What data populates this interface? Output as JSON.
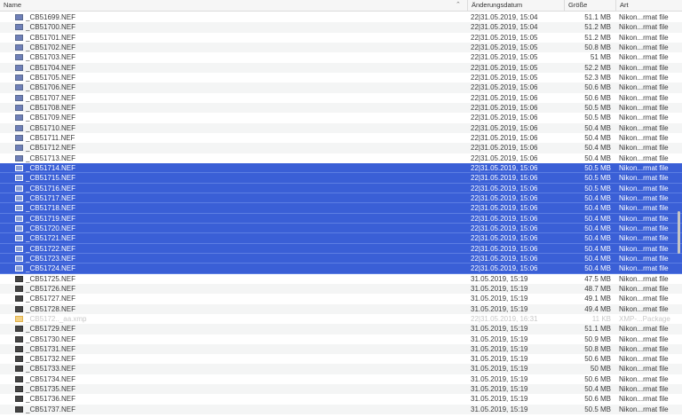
{
  "columns": {
    "name": "Name",
    "date": "Änderungsdatum",
    "size": "Größe",
    "kind": "Art",
    "sort_indicator": "⌃"
  },
  "rows": [
    {
      "name": "_CB51699.NEF",
      "date": "22|31.05.2019, 15:04",
      "size": "51.1 MB",
      "kind": "Nikon...rmat file",
      "selected": false,
      "icon": "nef-file-icon"
    },
    {
      "name": "_CB51700.NEF",
      "date": "22|31.05.2019, 15:04",
      "size": "51.2 MB",
      "kind": "Nikon...rmat file",
      "selected": false,
      "icon": "nef-file-icon"
    },
    {
      "name": "_CB51701.NEF",
      "date": "22|31.05.2019, 15:05",
      "size": "51.2 MB",
      "kind": "Nikon...rmat file",
      "selected": false,
      "icon": "nef-file-icon"
    },
    {
      "name": "_CB51702.NEF",
      "date": "22|31.05.2019, 15:05",
      "size": "50.8 MB",
      "kind": "Nikon...rmat file",
      "selected": false,
      "icon": "nef-file-icon"
    },
    {
      "name": "_CB51703.NEF",
      "date": "22|31.05.2019, 15:05",
      "size": "51 MB",
      "kind": "Nikon...rmat file",
      "selected": false,
      "icon": "nef-file-icon"
    },
    {
      "name": "_CB51704.NEF",
      "date": "22|31.05.2019, 15:05",
      "size": "52.2 MB",
      "kind": "Nikon...rmat file",
      "selected": false,
      "icon": "nef-file-icon"
    },
    {
      "name": "_CB51705.NEF",
      "date": "22|31.05.2019, 15:05",
      "size": "52.3 MB",
      "kind": "Nikon...rmat file",
      "selected": false,
      "icon": "nef-file-icon"
    },
    {
      "name": "_CB51706.NEF",
      "date": "22|31.05.2019, 15:06",
      "size": "50.6 MB",
      "kind": "Nikon...rmat file",
      "selected": false,
      "icon": "nef-file-icon"
    },
    {
      "name": "_CB51707.NEF",
      "date": "22|31.05.2019, 15:06",
      "size": "50.6 MB",
      "kind": "Nikon...rmat file",
      "selected": false,
      "icon": "nef-file-icon"
    },
    {
      "name": "_CB51708.NEF",
      "date": "22|31.05.2019, 15:06",
      "size": "50.5 MB",
      "kind": "Nikon...rmat file",
      "selected": false,
      "icon": "nef-file-icon"
    },
    {
      "name": "_CB51709.NEF",
      "date": "22|31.05.2019, 15:06",
      "size": "50.5 MB",
      "kind": "Nikon...rmat file",
      "selected": false,
      "icon": "nef-file-icon"
    },
    {
      "name": "_CB51710.NEF",
      "date": "22|31.05.2019, 15:06",
      "size": "50.4 MB",
      "kind": "Nikon...rmat file",
      "selected": false,
      "icon": "nef-file-icon"
    },
    {
      "name": "_CB51711.NEF",
      "date": "22|31.05.2019, 15:06",
      "size": "50.4 MB",
      "kind": "Nikon...rmat file",
      "selected": false,
      "icon": "nef-file-icon"
    },
    {
      "name": "_CB51712.NEF",
      "date": "22|31.05.2019, 15:06",
      "size": "50.4 MB",
      "kind": "Nikon...rmat file",
      "selected": false,
      "icon": "nef-file-icon"
    },
    {
      "name": "_CB51713.NEF",
      "date": "22|31.05.2019, 15:06",
      "size": "50.4 MB",
      "kind": "Nikon...rmat file",
      "selected": false,
      "icon": "nef-file-icon"
    },
    {
      "name": "_CB51714.NEF",
      "date": "22|31.05.2019, 15:06",
      "size": "50.5 MB",
      "kind": "Nikon...rmat file",
      "selected": true,
      "icon": "nef-file-icon"
    },
    {
      "name": "_CB51715.NEF",
      "date": "22|31.05.2019, 15:06",
      "size": "50.5 MB",
      "kind": "Nikon...rmat file",
      "selected": true,
      "icon": "nef-file-icon"
    },
    {
      "name": "_CB51716.NEF",
      "date": "22|31.05.2019, 15:06",
      "size": "50.5 MB",
      "kind": "Nikon...rmat file",
      "selected": true,
      "icon": "nef-file-icon"
    },
    {
      "name": "_CB51717.NEF",
      "date": "22|31.05.2019, 15:06",
      "size": "50.4 MB",
      "kind": "Nikon...rmat file",
      "selected": true,
      "icon": "nef-file-icon"
    },
    {
      "name": "_CB51718.NEF",
      "date": "22|31.05.2019, 15:06",
      "size": "50.4 MB",
      "kind": "Nikon...rmat file",
      "selected": true,
      "icon": "nef-file-icon"
    },
    {
      "name": "_CB51719.NEF",
      "date": "22|31.05.2019, 15:06",
      "size": "50.4 MB",
      "kind": "Nikon...rmat file",
      "selected": true,
      "icon": "nef-file-icon"
    },
    {
      "name": "_CB51720.NEF",
      "date": "22|31.05.2019, 15:06",
      "size": "50.4 MB",
      "kind": "Nikon...rmat file",
      "selected": true,
      "icon": "nef-file-icon"
    },
    {
      "name": "_CB51721.NEF",
      "date": "22|31.05.2019, 15:06",
      "size": "50.4 MB",
      "kind": "Nikon...rmat file",
      "selected": true,
      "icon": "nef-file-icon"
    },
    {
      "name": "_CB51722.NEF",
      "date": "22|31.05.2019, 15:06",
      "size": "50.4 MB",
      "kind": "Nikon...rmat file",
      "selected": true,
      "icon": "nef-file-icon"
    },
    {
      "name": "_CB51723.NEF",
      "date": "22|31.05.2019, 15:06",
      "size": "50.4 MB",
      "kind": "Nikon...rmat file",
      "selected": true,
      "icon": "nef-file-icon"
    },
    {
      "name": "_CB51724.NEF",
      "date": "22|31.05.2019, 15:06",
      "size": "50.4 MB",
      "kind": "Nikon...rmat file",
      "selected": true,
      "icon": "nef-file-icon"
    },
    {
      "name": "_CB51725.NEF",
      "date": "31.05.2019, 15:19",
      "size": "47.5 MB",
      "kind": "Nikon...rmat file",
      "selected": false,
      "icon": "nef-file-dark-icon"
    },
    {
      "name": "_CB51726.NEF",
      "date": "31.05.2019, 15:19",
      "size": "48.7 MB",
      "kind": "Nikon...rmat file",
      "selected": false,
      "icon": "nef-file-dark-icon"
    },
    {
      "name": "_CB51727.NEF",
      "date": "31.05.2019, 15:19",
      "size": "49.1 MB",
      "kind": "Nikon...rmat file",
      "selected": false,
      "icon": "nef-file-dark-icon"
    },
    {
      "name": "_CB51728.NEF",
      "date": "31.05.2019, 15:19",
      "size": "49.4 MB",
      "kind": "Nikon...rmat file",
      "selected": false,
      "icon": "nef-file-dark-icon"
    },
    {
      "name": "_CB5172.._aa.xmp",
      "date": "22|31.05.2019, 16:31",
      "size": "11 KB",
      "kind": "XMP-...Package",
      "selected": false,
      "dim": true,
      "icon": "package-icon"
    },
    {
      "name": "_CB51729.NEF",
      "date": "31.05.2019, 15:19",
      "size": "51.1 MB",
      "kind": "Nikon...rmat file",
      "selected": false,
      "icon": "nef-file-dark-icon"
    },
    {
      "name": "_CB51730.NEF",
      "date": "31.05.2019, 15:19",
      "size": "50.9 MB",
      "kind": "Nikon...rmat file",
      "selected": false,
      "icon": "nef-file-dark-icon"
    },
    {
      "name": "_CB51731.NEF",
      "date": "31.05.2019, 15:19",
      "size": "50.8 MB",
      "kind": "Nikon...rmat file",
      "selected": false,
      "icon": "nef-file-dark-icon"
    },
    {
      "name": "_CB51732.NEF",
      "date": "31.05.2019, 15:19",
      "size": "50.6 MB",
      "kind": "Nikon...rmat file",
      "selected": false,
      "icon": "nef-file-dark-icon"
    },
    {
      "name": "_CB51733.NEF",
      "date": "31.05.2019, 15:19",
      "size": "50 MB",
      "kind": "Nikon...rmat file",
      "selected": false,
      "icon": "nef-file-dark-icon"
    },
    {
      "name": "_CB51734.NEF",
      "date": "31.05.2019, 15:19",
      "size": "50.6 MB",
      "kind": "Nikon...rmat file",
      "selected": false,
      "icon": "nef-file-dark-icon"
    },
    {
      "name": "_CB51735.NEF",
      "date": "31.05.2019, 15:19",
      "size": "50.4 MB",
      "kind": "Nikon...rmat file",
      "selected": false,
      "icon": "nef-file-dark-icon"
    },
    {
      "name": "_CB51736.NEF",
      "date": "31.05.2019, 15:19",
      "size": "50.6 MB",
      "kind": "Nikon...rmat file",
      "selected": false,
      "icon": "nef-file-dark-icon"
    },
    {
      "name": "_CB51737.NEF",
      "date": "31.05.2019, 15:19",
      "size": "50.5 MB",
      "kind": "Nikon...rmat file",
      "selected": false,
      "icon": "nef-file-dark-icon"
    }
  ],
  "colors": {
    "selection": "#3a5fd6",
    "header_bg": "#f6f6f6",
    "alt_row": "#f4f5f5"
  }
}
